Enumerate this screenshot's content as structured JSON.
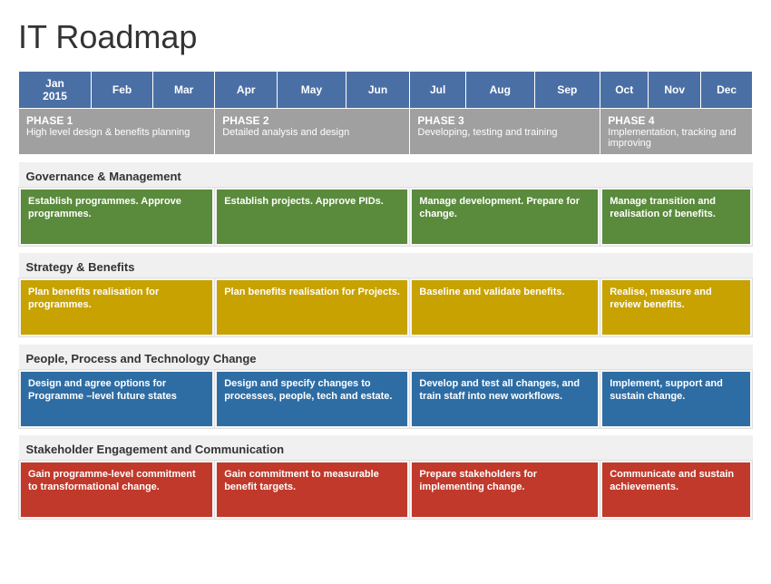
{
  "title": "IT Roadmap",
  "months": [
    {
      "label": "Jan\n2015",
      "display": "Jan 2015"
    },
    {
      "label": "Feb"
    },
    {
      "label": "Mar"
    },
    {
      "label": "Apr"
    },
    {
      "label": "May"
    },
    {
      "label": "Jun"
    },
    {
      "label": "Jul"
    },
    {
      "label": "Aug"
    },
    {
      "label": "Sep"
    },
    {
      "label": "Oct"
    },
    {
      "label": "Nov"
    },
    {
      "label": "Dec"
    }
  ],
  "phases": [
    {
      "title": "PHASE 1",
      "desc": "High level design & benefits planning",
      "span": 3
    },
    {
      "title": "PHASE 2",
      "desc": "Detailed analysis and design",
      "span": 3
    },
    {
      "title": "PHASE 3",
      "desc": "Developing, testing and training",
      "span": 3
    },
    {
      "title": "PHASE 4",
      "desc": "Implementation, tracking and improving",
      "span": 3
    }
  ],
  "sections": [
    {
      "name": "Governance & Management",
      "color": "green",
      "activities": [
        {
          "text": "Establish programmes. Approve programmes.",
          "span": 3
        },
        {
          "text": "Establish projects. Approve PIDs.",
          "span": 3
        },
        {
          "text": "Manage development. Prepare for change.",
          "span": 3
        },
        {
          "text": "Manage transition and realisation of benefits.",
          "span": 3
        }
      ]
    },
    {
      "name": "Strategy & Benefits",
      "color": "yellow",
      "activities": [
        {
          "text": "Plan benefits realisation for programmes.",
          "span": 3
        },
        {
          "text": "Plan benefits realisation for Projects.",
          "span": 3
        },
        {
          "text": "Baseline and validate benefits.",
          "span": 3
        },
        {
          "text": "Realise, measure and review benefits.",
          "span": 3
        }
      ]
    },
    {
      "name": "People, Process and Technology Change",
      "color": "blue",
      "activities": [
        {
          "text": "Design and agree options for Programme –level future states",
          "span": 3
        },
        {
          "text": "Design and specify changes to processes, people, tech and estate.",
          "span": 3
        },
        {
          "text": "Develop and test all changes, and train staff into new workflows.",
          "span": 3
        },
        {
          "text": "Implement, support and sustain change.",
          "span": 3
        }
      ]
    },
    {
      "name": "Stakeholder Engagement and Communication",
      "color": "red",
      "activities": [
        {
          "text": "Gain programme-level commitment to transformational change.",
          "span": 3
        },
        {
          "text": "Gain commitment to measurable benefit targets.",
          "span": 3
        },
        {
          "text": "Prepare stakeholders for implementing change.",
          "span": 3
        },
        {
          "text": "Communicate and sustain achievements.",
          "span": 3
        }
      ]
    }
  ]
}
